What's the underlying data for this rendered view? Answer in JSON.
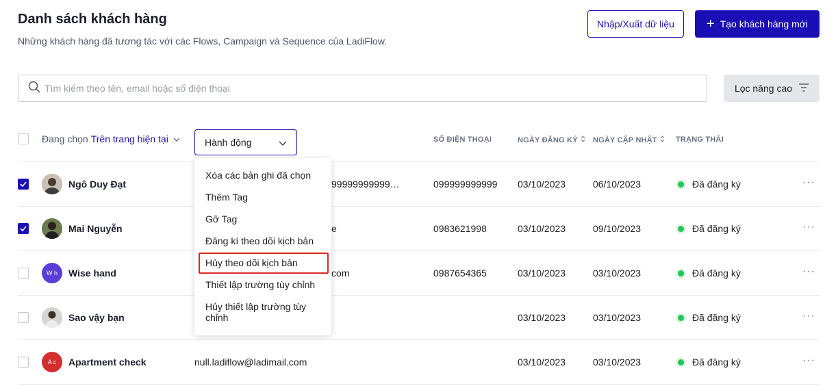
{
  "header": {
    "title": "Danh sách khách hàng",
    "subtitle": "Những khách hàng đã tương tác với các Flows, Campaign và Sequence của LadiFlow.",
    "import_label": "Nhập/Xuất dữ liệu",
    "create_label": "Tạo khách hàng mới"
  },
  "search": {
    "placeholder": "Tìm kiếm theo tên, email hoặc số điện thoại",
    "value": ""
  },
  "filter": {
    "label": "Lọc nâng cao"
  },
  "selection": {
    "prefix": "Đang chọn",
    "scope": "Trên trang hiện tại"
  },
  "action_select": {
    "label": "Hành động"
  },
  "columns": {
    "phone": "SỐ ĐIỆN THOẠI",
    "registered": "NGÀY ĐĂNG KÝ",
    "updated": "NGÀY CẬP NHẬT",
    "status": "TRẠNG THÁI"
  },
  "rows": [
    {
      "name": "Ngô Duy Đạt",
      "email": "99999999999…",
      "phone": "099999999999",
      "registered": "03/10/2023",
      "updated": "06/10/2023",
      "status": "Đã đăng ký",
      "checked": true,
      "avatar_initials": "",
      "avatar_color": "#8b8076"
    },
    {
      "name": "Mai Nguyễn",
      "email": "e",
      "phone": "0983621998",
      "registered": "03/10/2023",
      "updated": "09/10/2023",
      "status": "Đã đăng ký",
      "checked": true,
      "avatar_initials": "",
      "avatar_color": "#4a5a3a"
    },
    {
      "name": "Wise hand",
      "email": "com",
      "phone": "0987654365",
      "registered": "03/10/2023",
      "updated": "03/10/2023",
      "status": "Đã đăng ký",
      "checked": false,
      "avatar_initials": "W h",
      "avatar_color": "#5a3fd6"
    },
    {
      "name": "Sao vậy bạn",
      "email": "",
      "phone": "",
      "registered": "03/10/2023",
      "updated": "03/10/2023",
      "status": "Đã đăng ký",
      "checked": false,
      "avatar_initials": "",
      "avatar_color": "#b9b4ae"
    },
    {
      "name": "Apartment check",
      "email": "null.ladiflow@ladimail.com",
      "phone": "",
      "registered": "03/10/2023",
      "updated": "03/10/2023",
      "status": "Đã đăng ký",
      "checked": false,
      "avatar_initials": "A c",
      "avatar_color": "#d32f2f"
    }
  ],
  "dropdown": {
    "items": [
      "Xóa các bản ghi đã chọn",
      "Thêm Tag",
      "Gỡ Tag",
      "Đăng kí theo dõi kịch bản",
      "Hủy theo dõi kịch bản",
      "Thiết lập trường tùy chỉnh",
      "Hủy thiết lập trường tùy chỉnh"
    ],
    "highlighted_index": 4
  },
  "colors": {
    "primary": "#1a0fb5",
    "status_green": "#22c55e",
    "highlight_red": "#e02424"
  },
  "icons": {
    "search": "search-icon",
    "filter": "filter-icon",
    "plus": "plus-icon",
    "chevron": "chevron-down-icon",
    "sort": "sort-icon",
    "more": "more-horizontal-icon"
  }
}
